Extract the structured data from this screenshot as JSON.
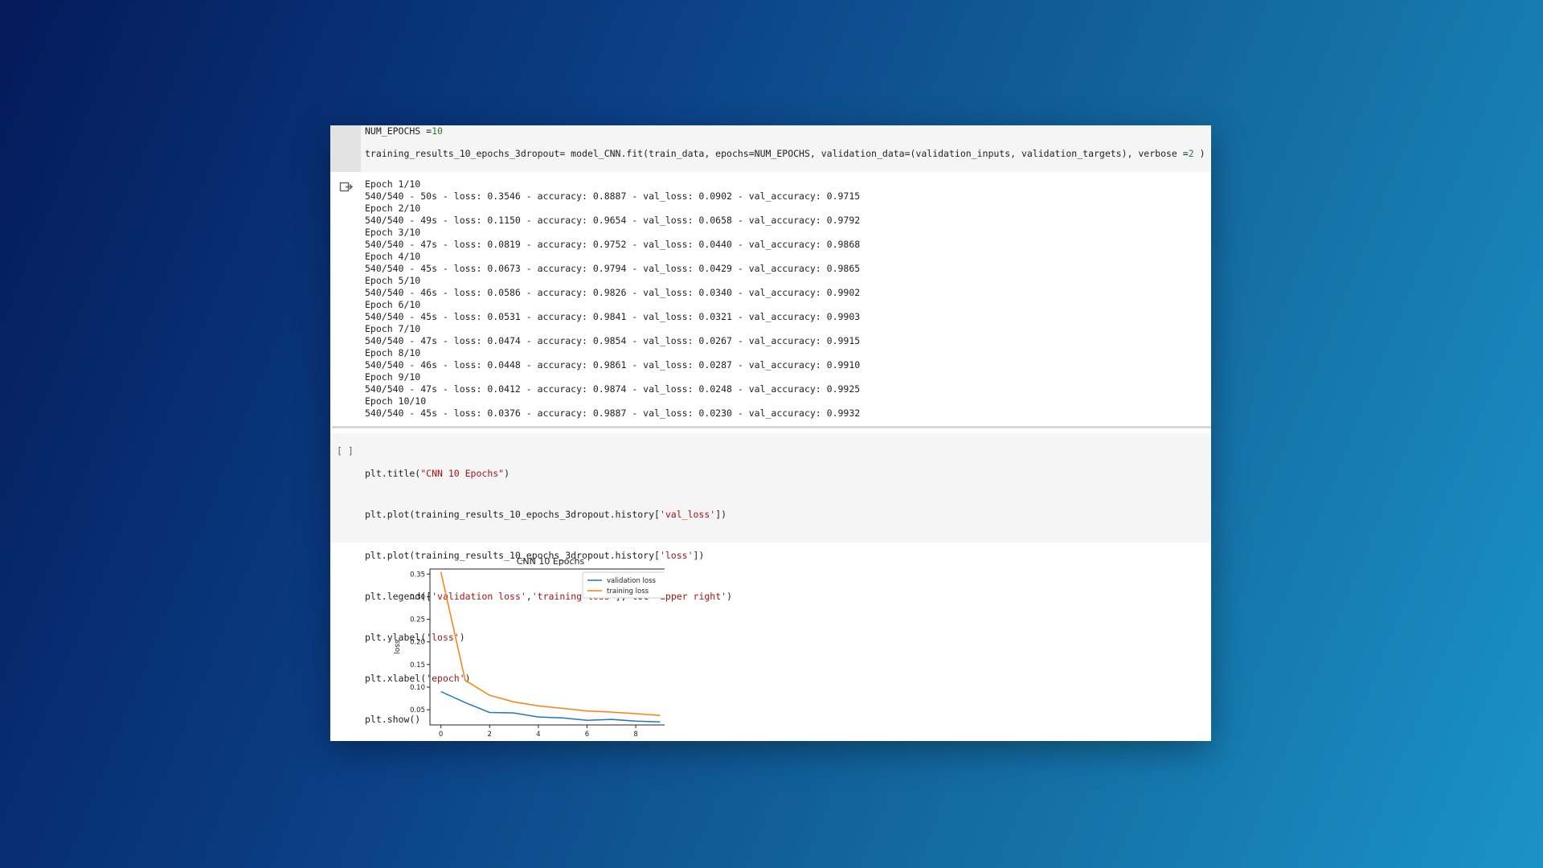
{
  "cell1": {
    "line1_prefix": "NUM_EPOCHS =",
    "line1_value": "10",
    "line2_prefix": "training_results_10_epochs_3dropout= model_CNN.fit(train_data, epochs=NUM_EPOCHS, validation_data=(validation_inputs, validation_targets), verbose =",
    "line2_value": "2",
    "line2_suffix": " )"
  },
  "output": {
    "icon": "output-redirect-icon",
    "lines": [
      "Epoch 1/10",
      "540/540 - 50s - loss: 0.3546 - accuracy: 0.8887 - val_loss: 0.0902 - val_accuracy: 0.9715",
      "Epoch 2/10",
      "540/540 - 49s - loss: 0.1150 - accuracy: 0.9654 - val_loss: 0.0658 - val_accuracy: 0.9792",
      "Epoch 3/10",
      "540/540 - 47s - loss: 0.0819 - accuracy: 0.9752 - val_loss: 0.0440 - val_accuracy: 0.9868",
      "Epoch 4/10",
      "540/540 - 45s - loss: 0.0673 - accuracy: 0.9794 - val_loss: 0.0429 - val_accuracy: 0.9865",
      "Epoch 5/10",
      "540/540 - 46s - loss: 0.0586 - accuracy: 0.9826 - val_loss: 0.0340 - val_accuracy: 0.9902",
      "Epoch 6/10",
      "540/540 - 45s - loss: 0.0531 - accuracy: 0.9841 - val_loss: 0.0321 - val_accuracy: 0.9903",
      "Epoch 7/10",
      "540/540 - 47s - loss: 0.0474 - accuracy: 0.9854 - val_loss: 0.0267 - val_accuracy: 0.9915",
      "Epoch 8/10",
      "540/540 - 46s - loss: 0.0448 - accuracy: 0.9861 - val_loss: 0.0287 - val_accuracy: 0.9910",
      "Epoch 9/10",
      "540/540 - 47s - loss: 0.0412 - accuracy: 0.9874 - val_loss: 0.0248 - val_accuracy: 0.9925",
      "Epoch 10/10",
      "540/540 - 45s - loss: 0.0376 - accuracy: 0.9887 - val_loss: 0.0230 - val_accuracy: 0.9932"
    ]
  },
  "cell2": {
    "run_bracket": "[ ]",
    "l1a": "plt.title(",
    "l1s": "\"CNN 10 Epochs\"",
    "l1b": ")",
    "l2a": "plt.plot(training_results_10_epochs_3dropout.history[",
    "l2s": "'val_loss'",
    "l2b": "])",
    "l3a": "plt.plot(training_results_10_epochs_3dropout.history[",
    "l3s": "'loss'",
    "l3b": "])",
    "l4a": "plt.legend([",
    "l4s1": "'validation loss'",
    "l4c": ",",
    "l4s2": "'training loss'",
    "l4d": "], loc=",
    "l4s3": "'upper right'",
    "l4e": ")",
    "l5a": "plt.ylabel(",
    "l5s": "'loss'",
    "l5b": ")",
    "l6a": "plt.xlabel(",
    "l6s": "'epoch'",
    "l6b": ")",
    "l7": "plt.show()"
  },
  "colors": {
    "validation_series": "#1f77b4",
    "training_series": "#ff7f0e",
    "code_number": "#2e7d32",
    "code_string": "#a31515"
  },
  "chart_data": {
    "type": "line",
    "title": "CNN 10 Epochs",
    "ylabel": "loss",
    "xlabel": "",
    "x": [
      0,
      1,
      2,
      3,
      4,
      5,
      6,
      7,
      8,
      9
    ],
    "series": [
      {
        "name": "validation loss",
        "values": [
          0.0902,
          0.0658,
          0.044,
          0.0429,
          0.034,
          0.0321,
          0.0267,
          0.0287,
          0.0248,
          0.023
        ]
      },
      {
        "name": "training loss",
        "values": [
          0.3546,
          0.115,
          0.0819,
          0.0673,
          0.0586,
          0.0531,
          0.0474,
          0.0448,
          0.0412,
          0.0376
        ]
      }
    ],
    "xticks": [
      "0",
      "2",
      "4",
      "6",
      "8"
    ],
    "yticks": [
      "0.05",
      "0.10",
      "0.15",
      "0.20",
      "0.25",
      "0.30",
      "0.35"
    ],
    "xlim": [
      -0.45,
      9.45
    ],
    "ylim": [
      0.0164,
      0.3612
    ],
    "legend_position": "upper right",
    "grid": false
  }
}
